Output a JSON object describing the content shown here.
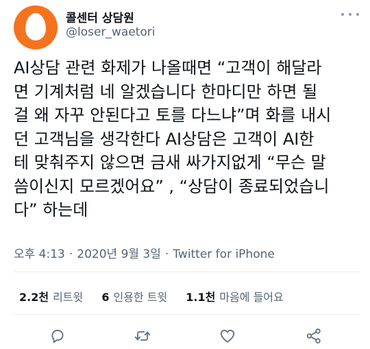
{
  "user": {
    "display_name": "콜센터 상담원",
    "handle": "@loser_waetori",
    "avatar_color": "#f5731f"
  },
  "tweet": {
    "text": "AI상담 관련 화제가 나올때면 “고객이 해달라\n면 기계처럼 네 알겠습니다 한마디만 하면 될\n걸 왜 자꾸 안된다고 토를 다느냐”며 화를 내시\n던 고객님을 생각한다 AI상담은 고객이 AI한\n테 맞춰주지 않으면 금새 싸가지없게 “무슨 말\n씀이신지 모르겠어요” , “상담이 종료되었습니\n다” 하는데",
    "time": "오후 4:13",
    "date": "2020년 9월 3일",
    "source": "Twitter for iPhone"
  },
  "stats": {
    "retweets_count": "2.2천",
    "retweets_label": "리트윗",
    "quotes_count": "6",
    "quotes_label": "인용한 트윗",
    "likes_count": "1.1천",
    "likes_label": "마음에 들어요"
  },
  "actions": {
    "reply_icon": "reply-icon",
    "retweet_icon": "retweet-icon",
    "like_icon": "heart-icon",
    "share_icon": "share-icon",
    "icon_color": "#657786"
  }
}
